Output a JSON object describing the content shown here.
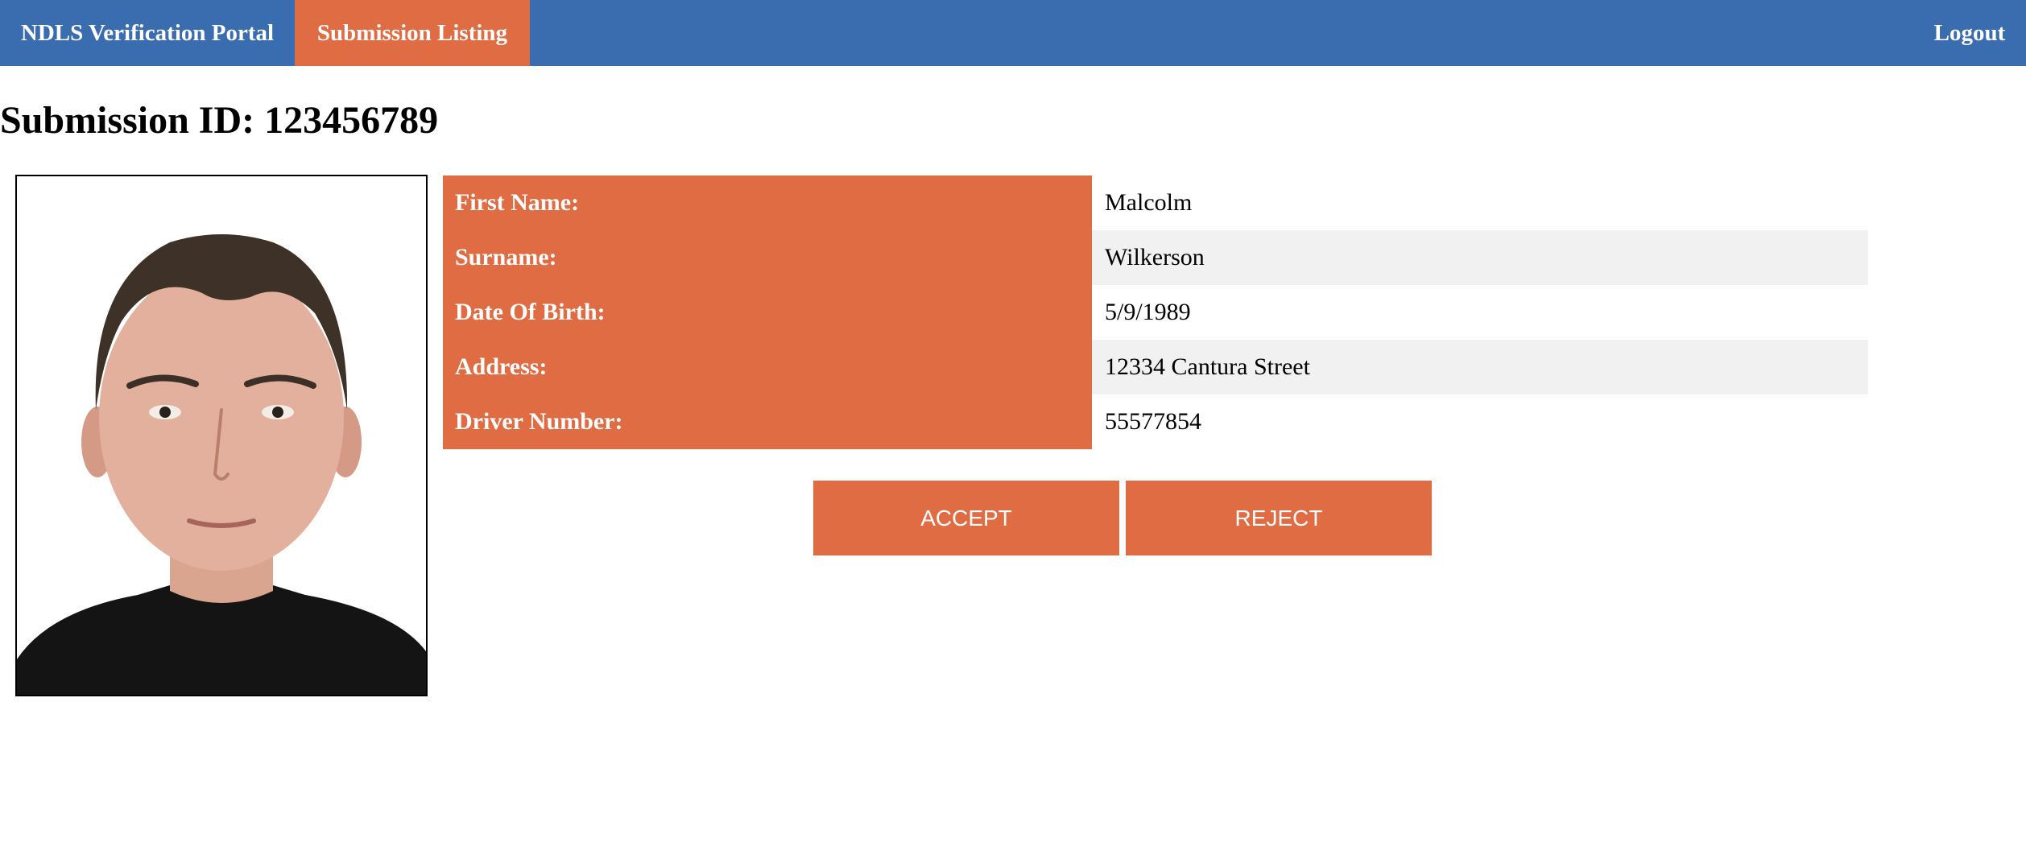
{
  "nav": {
    "brand": "NDLS Verification Portal",
    "active_tab": "Submission Listing",
    "logout": "Logout"
  },
  "page": {
    "title": "Submission ID: 123456789"
  },
  "details": [
    {
      "label": "First Name:",
      "value": "Malcolm"
    },
    {
      "label": "Surname:",
      "value": "Wilkerson"
    },
    {
      "label": "Date Of Birth:",
      "value": "5/9/1989"
    },
    {
      "label": "Address:",
      "value": "12334 Cantura Street"
    },
    {
      "label": "Driver Number:",
      "value": "55577854"
    }
  ],
  "actions": {
    "accept": "ACCEPT",
    "reject": "REJECT"
  },
  "colors": {
    "navbar": "#3a6db0",
    "accent": "#e06c43",
    "row_alt": "#f1f1f1"
  }
}
